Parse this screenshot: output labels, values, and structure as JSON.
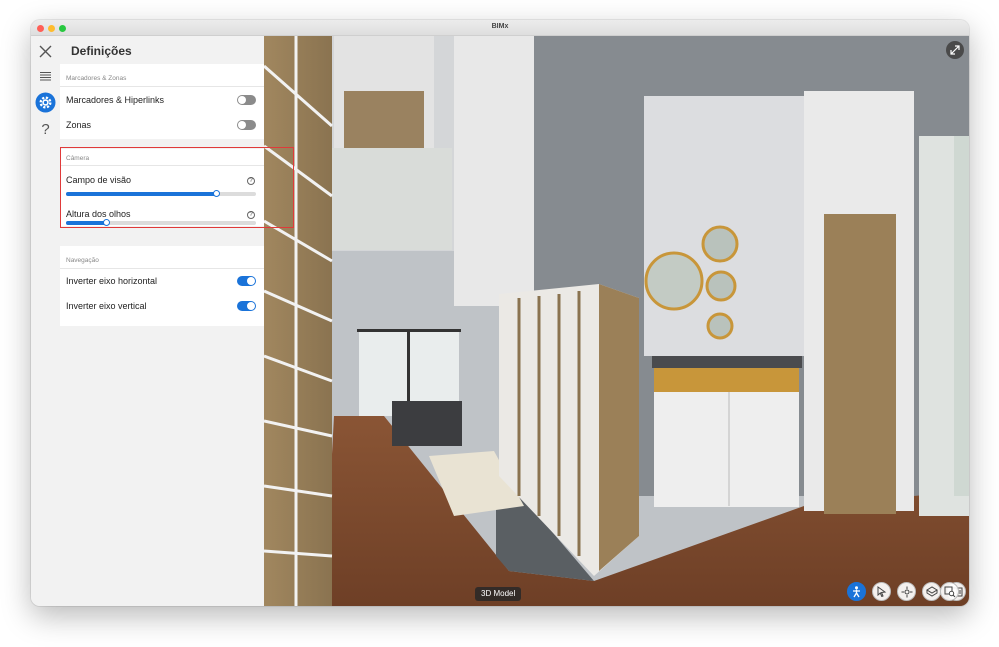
{
  "window": {
    "title": "BIMx"
  },
  "rail": {
    "close_icon": "close-icon",
    "items": [
      {
        "name": "list-icon"
      },
      {
        "name": "gear-icon",
        "active": true
      },
      {
        "name": "help-icon"
      }
    ]
  },
  "settings": {
    "title": "Definições",
    "markers": {
      "section_label": "Marcadores & Zonas",
      "items": [
        {
          "label": "Marcadores & Hiperlinks",
          "enabled": false
        },
        {
          "label": "Zonas",
          "enabled": false
        }
      ]
    },
    "camera": {
      "section_label": "Câmera",
      "sliders": [
        {
          "label": "Campo de visão",
          "value_percent": 79
        },
        {
          "label": "Altura dos olhos",
          "value_percent": 21
        }
      ]
    },
    "navigation": {
      "section_label": "Navegação",
      "items": [
        {
          "label": "Inverter eixo horizontal",
          "enabled": true
        },
        {
          "label": "Inverter eixo vertical",
          "enabled": true
        }
      ]
    }
  },
  "viewport": {
    "mode_label": "3D Model",
    "nav_buttons": [
      {
        "name": "walk-mode-icon",
        "active": true
      },
      {
        "name": "select-cursor-icon",
        "active": false
      },
      {
        "name": "orbit-icon",
        "active": false
      },
      {
        "name": "section-box-icon",
        "active": false
      },
      {
        "name": "layout-book-icon",
        "active": false
      },
      {
        "name": "zoom-search-icon",
        "active": false
      }
    ]
  },
  "colors": {
    "accent": "#1a73d9",
    "highlight": "#e03a3a"
  }
}
